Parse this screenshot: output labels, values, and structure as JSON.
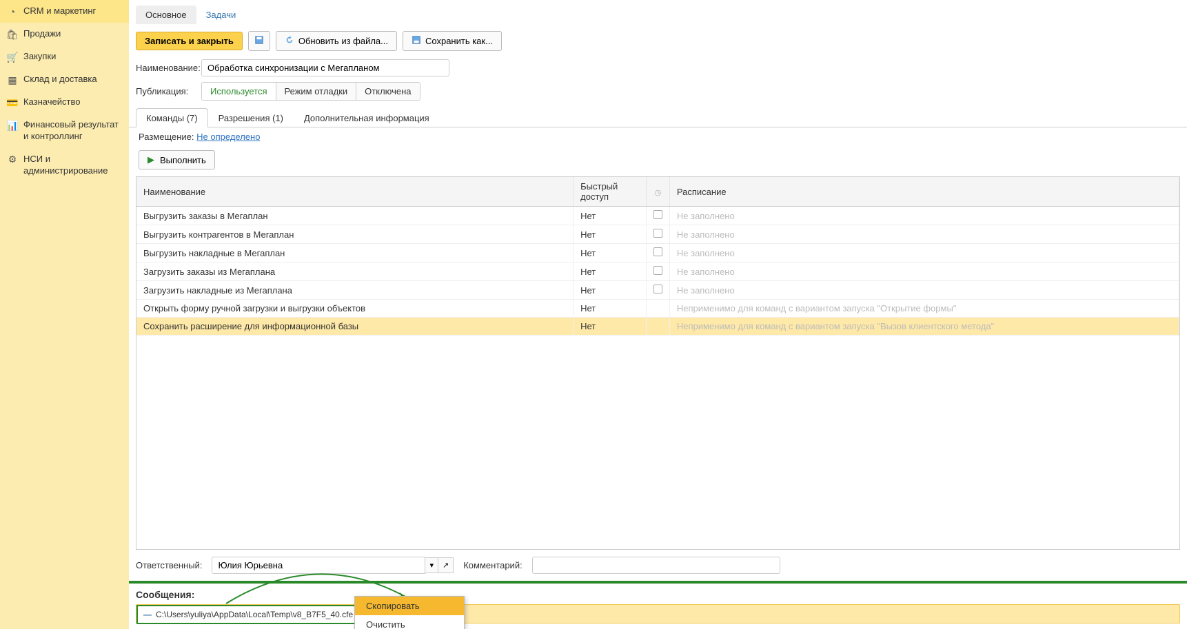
{
  "sidebar": {
    "items": [
      {
        "icon": "◔",
        "label": "CRM и маркетинг"
      },
      {
        "icon": "🛍",
        "label": "Продажи"
      },
      {
        "icon": "🛒",
        "label": "Закупки"
      },
      {
        "icon": "▦",
        "label": "Склад и доставка"
      },
      {
        "icon": "💳",
        "label": "Казначейство"
      },
      {
        "icon": "📊",
        "label": "Финансовый результат и контроллинг"
      },
      {
        "icon": "⚙",
        "label": "НСИ и администрирование"
      }
    ]
  },
  "top_tabs": {
    "main": "Основное",
    "tasks": "Задачи"
  },
  "toolbar": {
    "save_close": "Записать и закрыть",
    "update_file": "Обновить из файла...",
    "save_as": "Сохранить как..."
  },
  "form": {
    "name_label": "Наименование:",
    "name_value": "Обработка синхронизации с Мегапланом",
    "pub_label": "Публикация:",
    "pub_options": {
      "used": "Используется",
      "debug": "Режим отладки",
      "off": "Отключена"
    }
  },
  "sub_tabs": {
    "cmds": "Команды (7)",
    "perms": "Разрешения (1)",
    "info": "Дополнительная информация"
  },
  "placement": {
    "label": "Размещение:",
    "value": "Не определено"
  },
  "execute": "Выполнить",
  "table": {
    "headers": {
      "name": "Наименование",
      "quick": "Быстрый доступ",
      "sched": "Расписание"
    },
    "not_filled": "Не заполнено",
    "na_open": "Неприменимо для команд с вариантом запуска \"Открытие формы\"",
    "na_client": "Неприменимо для команд с вариантом запуска \"Вызов клиентского метода\"",
    "rows": [
      {
        "name": "Выгрузить заказы в  Мегаплан",
        "quick": "Нет",
        "chk": true,
        "sched": "nf"
      },
      {
        "name": "Выгрузить контрагентов в Мегаплан",
        "quick": "Нет",
        "chk": true,
        "sched": "nf"
      },
      {
        "name": "Выгрузить накладные в Мегаплан",
        "quick": "Нет",
        "chk": true,
        "sched": "nf"
      },
      {
        "name": "Загрузить заказы из Мегаплана",
        "quick": "Нет",
        "chk": true,
        "sched": "nf"
      },
      {
        "name": "Загрузить накладные из Мегаплана",
        "quick": "Нет",
        "chk": true,
        "sched": "nf"
      },
      {
        "name": "Открыть форму ручной загрузки и выгрузки объектов",
        "quick": "Нет",
        "chk": false,
        "sched": "open"
      },
      {
        "name": "Сохранить расширение для информационной базы",
        "quick": "Нет",
        "chk": false,
        "sched": "client"
      }
    ]
  },
  "bottom": {
    "resp_label": "Ответственный:",
    "resp_value": "Юлия Юрьевна",
    "comment_label": "Комментарий:",
    "comment_value": ""
  },
  "messages": {
    "label": "Сообщения:",
    "path": "C:\\Users\\yuliya\\AppData\\Local\\Temp\\v8_B7F5_40.cfe"
  },
  "context": {
    "copy": "Скопировать",
    "clear": "Очистить"
  }
}
